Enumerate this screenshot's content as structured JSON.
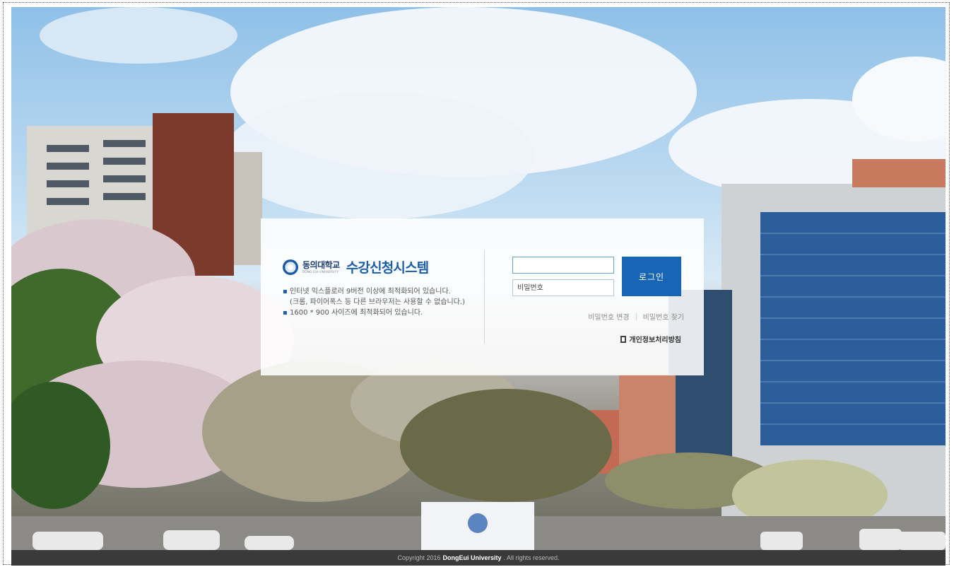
{
  "login_panel": {
    "university_name": "동의대학교",
    "university_name_en": "DONG-EUI UNIVERSITY",
    "system_title": "수강신청시스템",
    "notes": [
      "인터넷 익스플로러 9버전 이상에 최적화되어 있습니다.",
      "(크롬, 파이어폭스 등 다른 브라우저는 사용할 수 없습니다.)",
      "1600 * 900 사이즈에 최적화되어 있습니다."
    ],
    "id_field": {
      "value": "",
      "placeholder": ""
    },
    "password_field": {
      "placeholder": "비밀번호"
    },
    "login_button": "로그인",
    "links": {
      "change_password": "비밀번호 변경",
      "find_password": "비밀번호 찾기"
    },
    "privacy_policy": "개인정보처리방침"
  },
  "footer": {
    "copyright_prefix": "Copyright 2016",
    "brand": "DongEui University",
    "copyright_suffix": ". All rights reserved."
  },
  "colors": {
    "accent": "#1865b5",
    "title": "#1a5ea9",
    "footer_bg": "#3a3a3a"
  }
}
